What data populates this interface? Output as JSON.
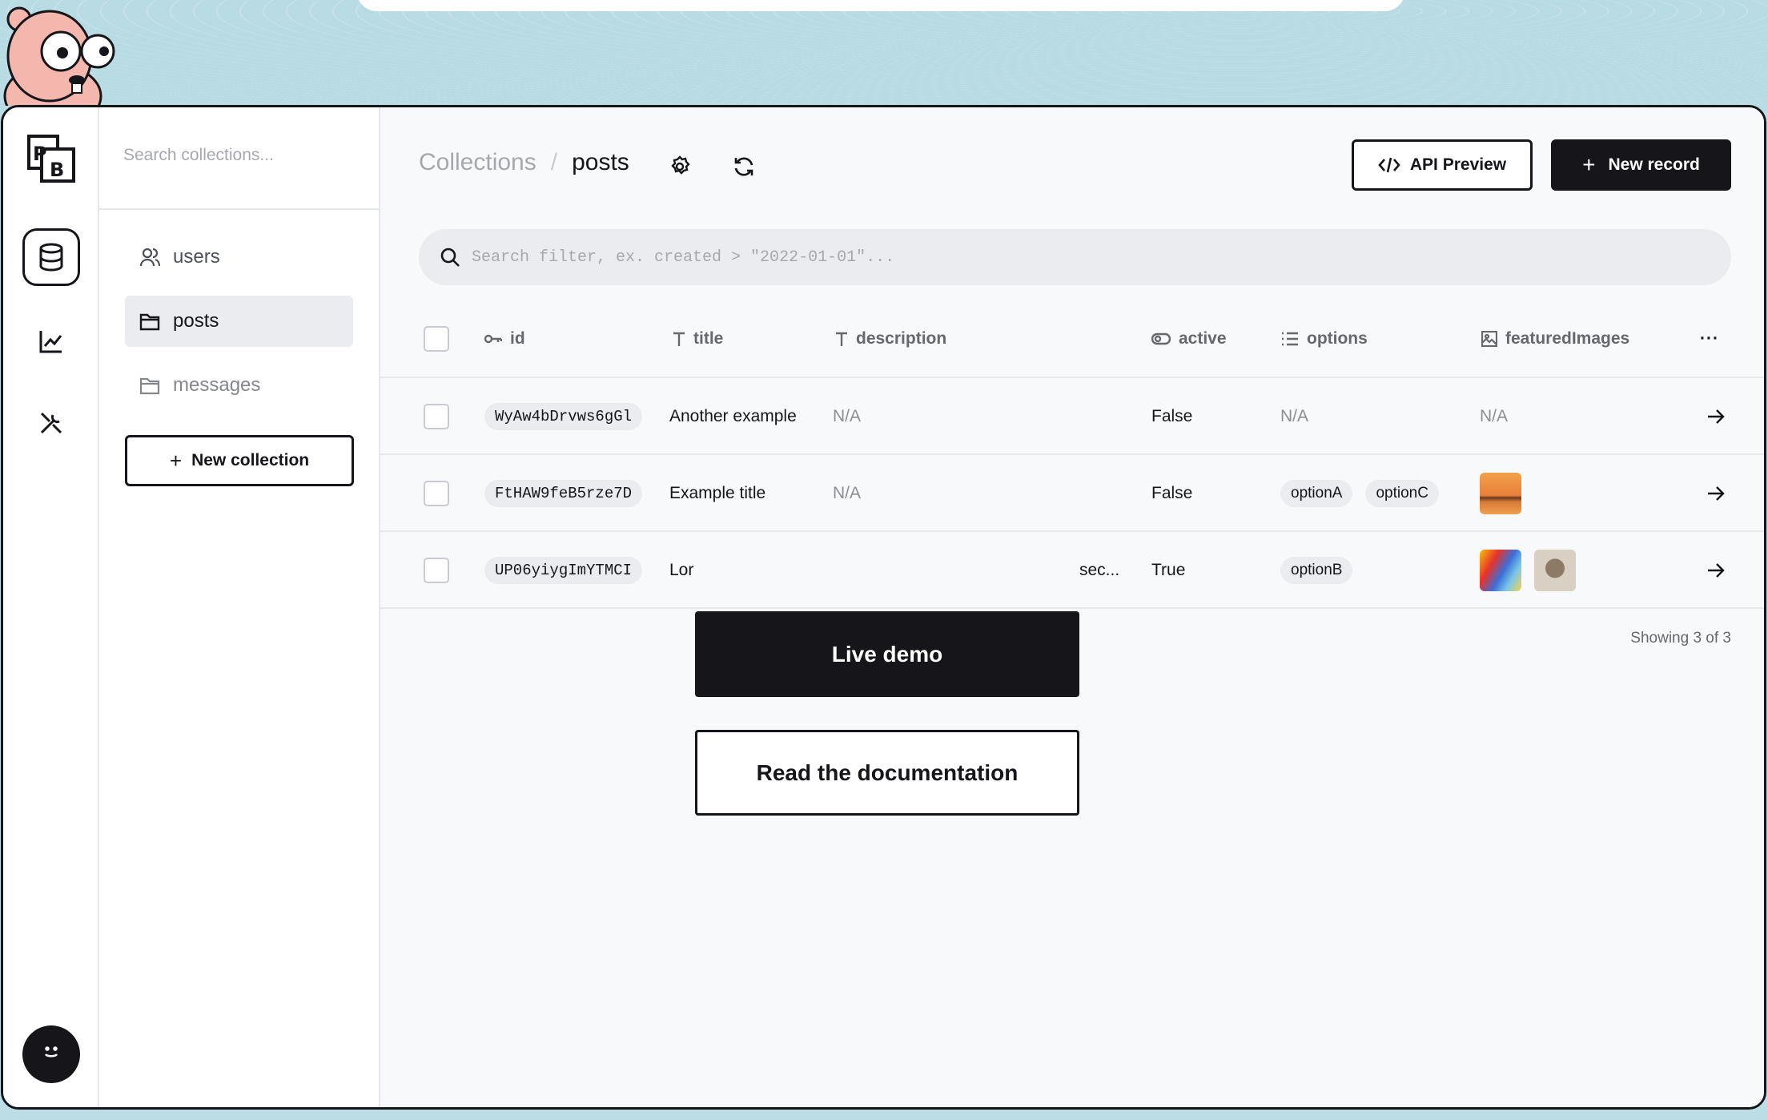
{
  "sidebar": {
    "search_placeholder": "Search collections...",
    "items": [
      {
        "label": "users",
        "icon": "user-icon"
      },
      {
        "label": "posts",
        "icon": "folder-icon"
      },
      {
        "label": "messages",
        "icon": "folder-icon"
      }
    ],
    "new_collection_label": "New collection"
  },
  "header": {
    "breadcrumb_root": "Collections",
    "breadcrumb_sep": "/",
    "breadcrumb_current": "posts",
    "api_preview_label": "API Preview",
    "new_record_label": "New record"
  },
  "filter": {
    "placeholder": "Search filter, ex. created > \"2022-01-01\"..."
  },
  "table": {
    "columns": [
      {
        "label": "id",
        "icon": "key-icon"
      },
      {
        "label": "title",
        "icon": "text-icon"
      },
      {
        "label": "description",
        "icon": "text-icon"
      },
      {
        "label": "active",
        "icon": "toggle-icon"
      },
      {
        "label": "options",
        "icon": "list-icon"
      },
      {
        "label": "featuredImages",
        "icon": "image-icon"
      }
    ],
    "more_label": "···",
    "rows": [
      {
        "id": "WyAw4bDrvws6gGl",
        "title": "Another example",
        "description": "N/A",
        "active": "False",
        "options": "N/A",
        "images": "N/A"
      },
      {
        "id": "FtHAW9feB5rze7D",
        "title": "Example title",
        "description": "N/A",
        "active": "False",
        "option_a": "optionA",
        "option_b": "optionC"
      },
      {
        "id": "UP06yiygImYTMCI",
        "title": "Lor",
        "description": "sec...",
        "active": "True",
        "option_a": "optionB"
      }
    ],
    "showing": "Showing 3 of 3"
  },
  "overlay": {
    "live_demo_label": "Live demo",
    "docs_label": "Read the documentation"
  },
  "colors": {
    "accent": "#16161a",
    "bg_top": "#bcdce6",
    "muted": "#eaecef"
  }
}
